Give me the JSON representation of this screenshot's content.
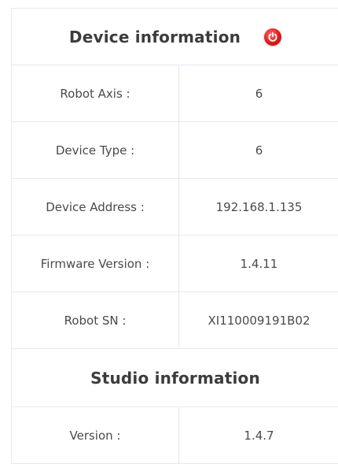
{
  "device": {
    "title": "Device information",
    "power_icon": "power-icon",
    "power_color": "#e01919",
    "rows": [
      {
        "label": "Robot Axis :",
        "value": "6"
      },
      {
        "label": "Device Type :",
        "value": "6"
      },
      {
        "label": "Device Address :",
        "value": "192.168.1.135"
      },
      {
        "label": "Firmware Version :",
        "value": "1.4.11"
      },
      {
        "label": "Robot SN :",
        "value": "XI110009191B02"
      }
    ]
  },
  "studio": {
    "title": "Studio information",
    "rows": [
      {
        "label": "Version :",
        "value": "1.4.7"
      }
    ]
  }
}
